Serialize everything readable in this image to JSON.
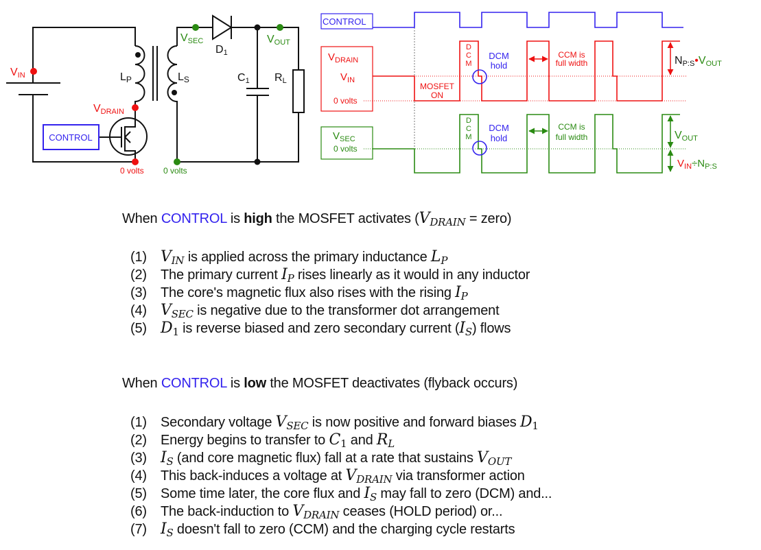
{
  "colors": {
    "red": "#ee1111",
    "green": "#2a8a12",
    "blue": "#3322ee",
    "black": "#111111"
  },
  "circuit": {
    "vin": {
      "main": "V",
      "sub": "IN"
    },
    "lp": {
      "main": "L",
      "sub": "P"
    },
    "ls": {
      "main": "L",
      "sub": "S"
    },
    "vdrain": {
      "main": "V",
      "sub": "DRAIN"
    },
    "vsec": {
      "main": "V",
      "sub": "SEC"
    },
    "d1": {
      "main": "D",
      "sub": "1"
    },
    "vout": {
      "main": "V",
      "sub": "OUT"
    },
    "c1": {
      "main": "C",
      "sub": "1"
    },
    "rl": {
      "main": "R",
      "sub": "L"
    },
    "control": "CONTROL",
    "zero_primary": "0 volts",
    "zero_secondary": "0 volts"
  },
  "waveforms": {
    "control_label": "CONTROL",
    "vdrain_label": {
      "main": "V",
      "sub": "DRAIN"
    },
    "vin_label": {
      "main": "V",
      "sub": "IN"
    },
    "drain_zero": "0 volts",
    "vsec_label": {
      "main": "V",
      "sub": "SEC"
    },
    "sec_zero": "0 volts",
    "mosfet_on": [
      "MOSFET",
      "ON"
    ],
    "dcm_vertical": [
      "D",
      "C",
      "M"
    ],
    "dcm_hold": [
      "DCM",
      "hold"
    ],
    "ccm": [
      "CCM is",
      "full width"
    ],
    "np_vout": {
      "n": "N",
      "nsub": "P:S",
      "dot": "•",
      "v": "V",
      "vsub": "OUT"
    },
    "vout": {
      "main": "V",
      "sub": "OUT"
    },
    "vin_div": {
      "v": "V",
      "vsub": "IN",
      "div": "÷",
      "n": "N",
      "nsub": "P:S"
    }
  },
  "section_high": {
    "heading": [
      {
        "t": "When "
      },
      {
        "c": "CONTROL"
      },
      {
        "t": " is "
      },
      {
        "b": "high"
      },
      {
        "t": " the MOSFET activates ("
      },
      {
        "m": "V",
        "sub": "DRAIN"
      },
      {
        "t": " = zero)"
      }
    ],
    "items": [
      {
        "num": "(1)",
        "parts": [
          {
            "m": "V",
            "sub": "IN"
          },
          {
            "t": " is applied across the primary inductance "
          },
          {
            "m": "L",
            "sub": "P"
          }
        ]
      },
      {
        "num": "(2)",
        "parts": [
          {
            "t": "The primary current "
          },
          {
            "m": "I",
            "sub": "P"
          },
          {
            "t": " rises linearly as it would in any inductor"
          }
        ]
      },
      {
        "num": "(3)",
        "parts": [
          {
            "t": "The core's magnetic flux also rises with the rising "
          },
          {
            "m": "I",
            "sub": "P"
          }
        ]
      },
      {
        "num": "(4)",
        "parts": [
          {
            "m": "V",
            "sub": "SEC"
          },
          {
            "t": " is negative due to the transformer dot arrangement"
          }
        ]
      },
      {
        "num": "(5)",
        "parts": [
          {
            "m": "D",
            "sub": "1",
            "up": true
          },
          {
            "t": " is reverse biased and zero secondary current ("
          },
          {
            "m": "I",
            "sub": "S"
          },
          {
            "t": ") flows"
          }
        ]
      }
    ]
  },
  "section_low": {
    "heading": [
      {
        "t": "When "
      },
      {
        "c": "CONTROL"
      },
      {
        "t": " is "
      },
      {
        "b": "low"
      },
      {
        "t": " the MOSFET deactivates (flyback occurs)"
      }
    ],
    "items": [
      {
        "num": "(1)",
        "parts": [
          {
            "t": "Secondary voltage "
          },
          {
            "m": "V",
            "sub": "SEC"
          },
          {
            "t": " is now positive and forward biases "
          },
          {
            "m": "D",
            "sub": "1",
            "up": true
          }
        ]
      },
      {
        "num": "(2)",
        "parts": [
          {
            "t": "Energy begins to transfer to "
          },
          {
            "m": "C",
            "sub": "1",
            "up": true
          },
          {
            "t": " and "
          },
          {
            "m": "R",
            "sub": "L"
          }
        ]
      },
      {
        "num": "(3)",
        "parts": [
          {
            "m": "I",
            "sub": "S"
          },
          {
            "t": " (and core magnetic flux) fall at a rate that sustains "
          },
          {
            "m": "V",
            "sub": "OUT"
          }
        ]
      },
      {
        "num": "(4)",
        "parts": [
          {
            "t": "This back-induces a voltage at "
          },
          {
            "m": "V",
            "sub": "DRAIN"
          },
          {
            "t": " via transformer action"
          }
        ]
      },
      {
        "num": "(5)",
        "parts": [
          {
            "t": "Some time later, the core flux and "
          },
          {
            "m": "I",
            "sub": "S"
          },
          {
            "t": " may fall to zero (DCM) and..."
          }
        ]
      },
      {
        "num": "(6)",
        "parts": [
          {
            "t": "The back-induction to "
          },
          {
            "m": "V",
            "sub": "DRAIN"
          },
          {
            "t": " ceases (HOLD period) or..."
          }
        ]
      },
      {
        "num": "(7)",
        "parts": [
          {
            "m": "I",
            "sub": "S"
          },
          {
            "t": " doesn't fall to zero (CCM) and the charging cycle restarts"
          }
        ]
      }
    ]
  }
}
